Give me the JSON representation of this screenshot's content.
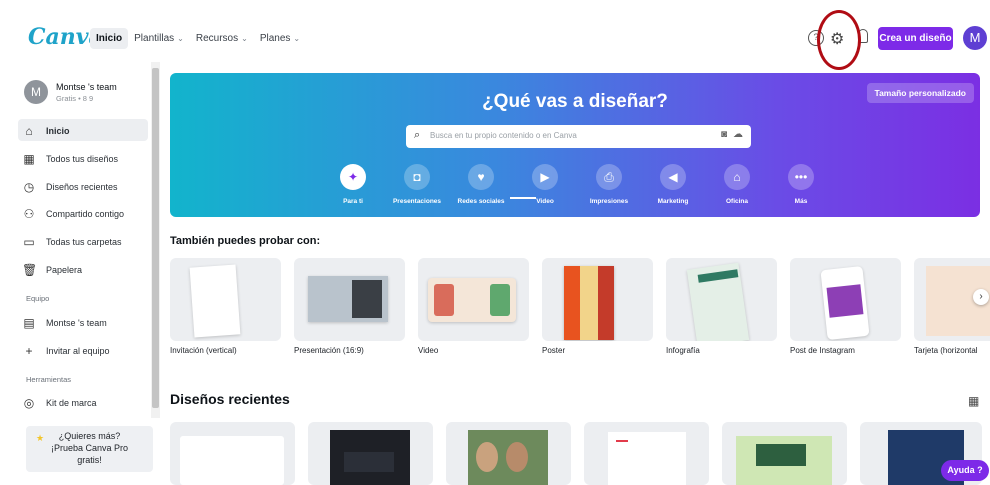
{
  "header": {
    "logo": "Canva",
    "nav": [
      {
        "label": "Inicio",
        "active": true
      },
      {
        "label": "Plantillas",
        "chevron": "⌄"
      },
      {
        "label": "Recursos",
        "chevron": "⌄"
      },
      {
        "label": "Planes",
        "chevron": "⌄"
      }
    ],
    "create_button": "Crea un diseño",
    "avatar_letter": "M"
  },
  "sidebar": {
    "team_avatar": "M",
    "team_name": "Montse 's team",
    "team_sub": "Gratis • 8 9",
    "items": [
      {
        "label": "Inicio",
        "icon": "home-icon"
      },
      {
        "label": "Todos tus diseños",
        "icon": "grid-icon"
      },
      {
        "label": "Diseños recientes",
        "icon": "clock-icon"
      },
      {
        "label": "Compartido contigo",
        "icon": "shared-icon"
      },
      {
        "label": "Todas tus carpetas",
        "icon": "folder-icon"
      },
      {
        "label": "Papelera",
        "icon": "trash-icon"
      }
    ],
    "section_team": "Equipo",
    "team_items": [
      {
        "label": "Montse 's team",
        "icon": "team-icon"
      },
      {
        "label": "Invitar al equipo",
        "icon": "plus-icon"
      }
    ],
    "section_tools": "Herramientas",
    "tools_items": [
      {
        "label": "Kit de marca",
        "icon": "brand-icon"
      }
    ],
    "promo": [
      "¿Quieres más?",
      "¡Prueba Canva Pro",
      "gratis!"
    ]
  },
  "hero": {
    "title": "¿Qué vas a diseñar?",
    "custom_size": "Tamaño personalizado",
    "search_placeholder": "Busca en tu propio contenido o en Canva",
    "categories": [
      {
        "label": "Para ti",
        "glyph": "✦"
      },
      {
        "label": "Presentaciones",
        "glyph": "◘"
      },
      {
        "label": "Redes sociales",
        "glyph": "♥"
      },
      {
        "label": "Video",
        "glyph": "▶"
      },
      {
        "label": "Impresiones",
        "glyph": "⎙"
      },
      {
        "label": "Marketing",
        "glyph": "◀"
      },
      {
        "label": "Oficina",
        "glyph": "⌂"
      },
      {
        "label": "Más",
        "glyph": "•••"
      }
    ]
  },
  "suggestions": {
    "title": "También puedes probar con:",
    "items": [
      "Invitación (vertical)",
      "Presentación (16:9)",
      "Video",
      "Poster",
      "Infografía",
      "Post de Instagram",
      "Tarjeta (horizontal"
    ]
  },
  "recent": {
    "title": "Diseños recientes"
  },
  "help": {
    "label": "Ayuda",
    "glyph": "?"
  }
}
